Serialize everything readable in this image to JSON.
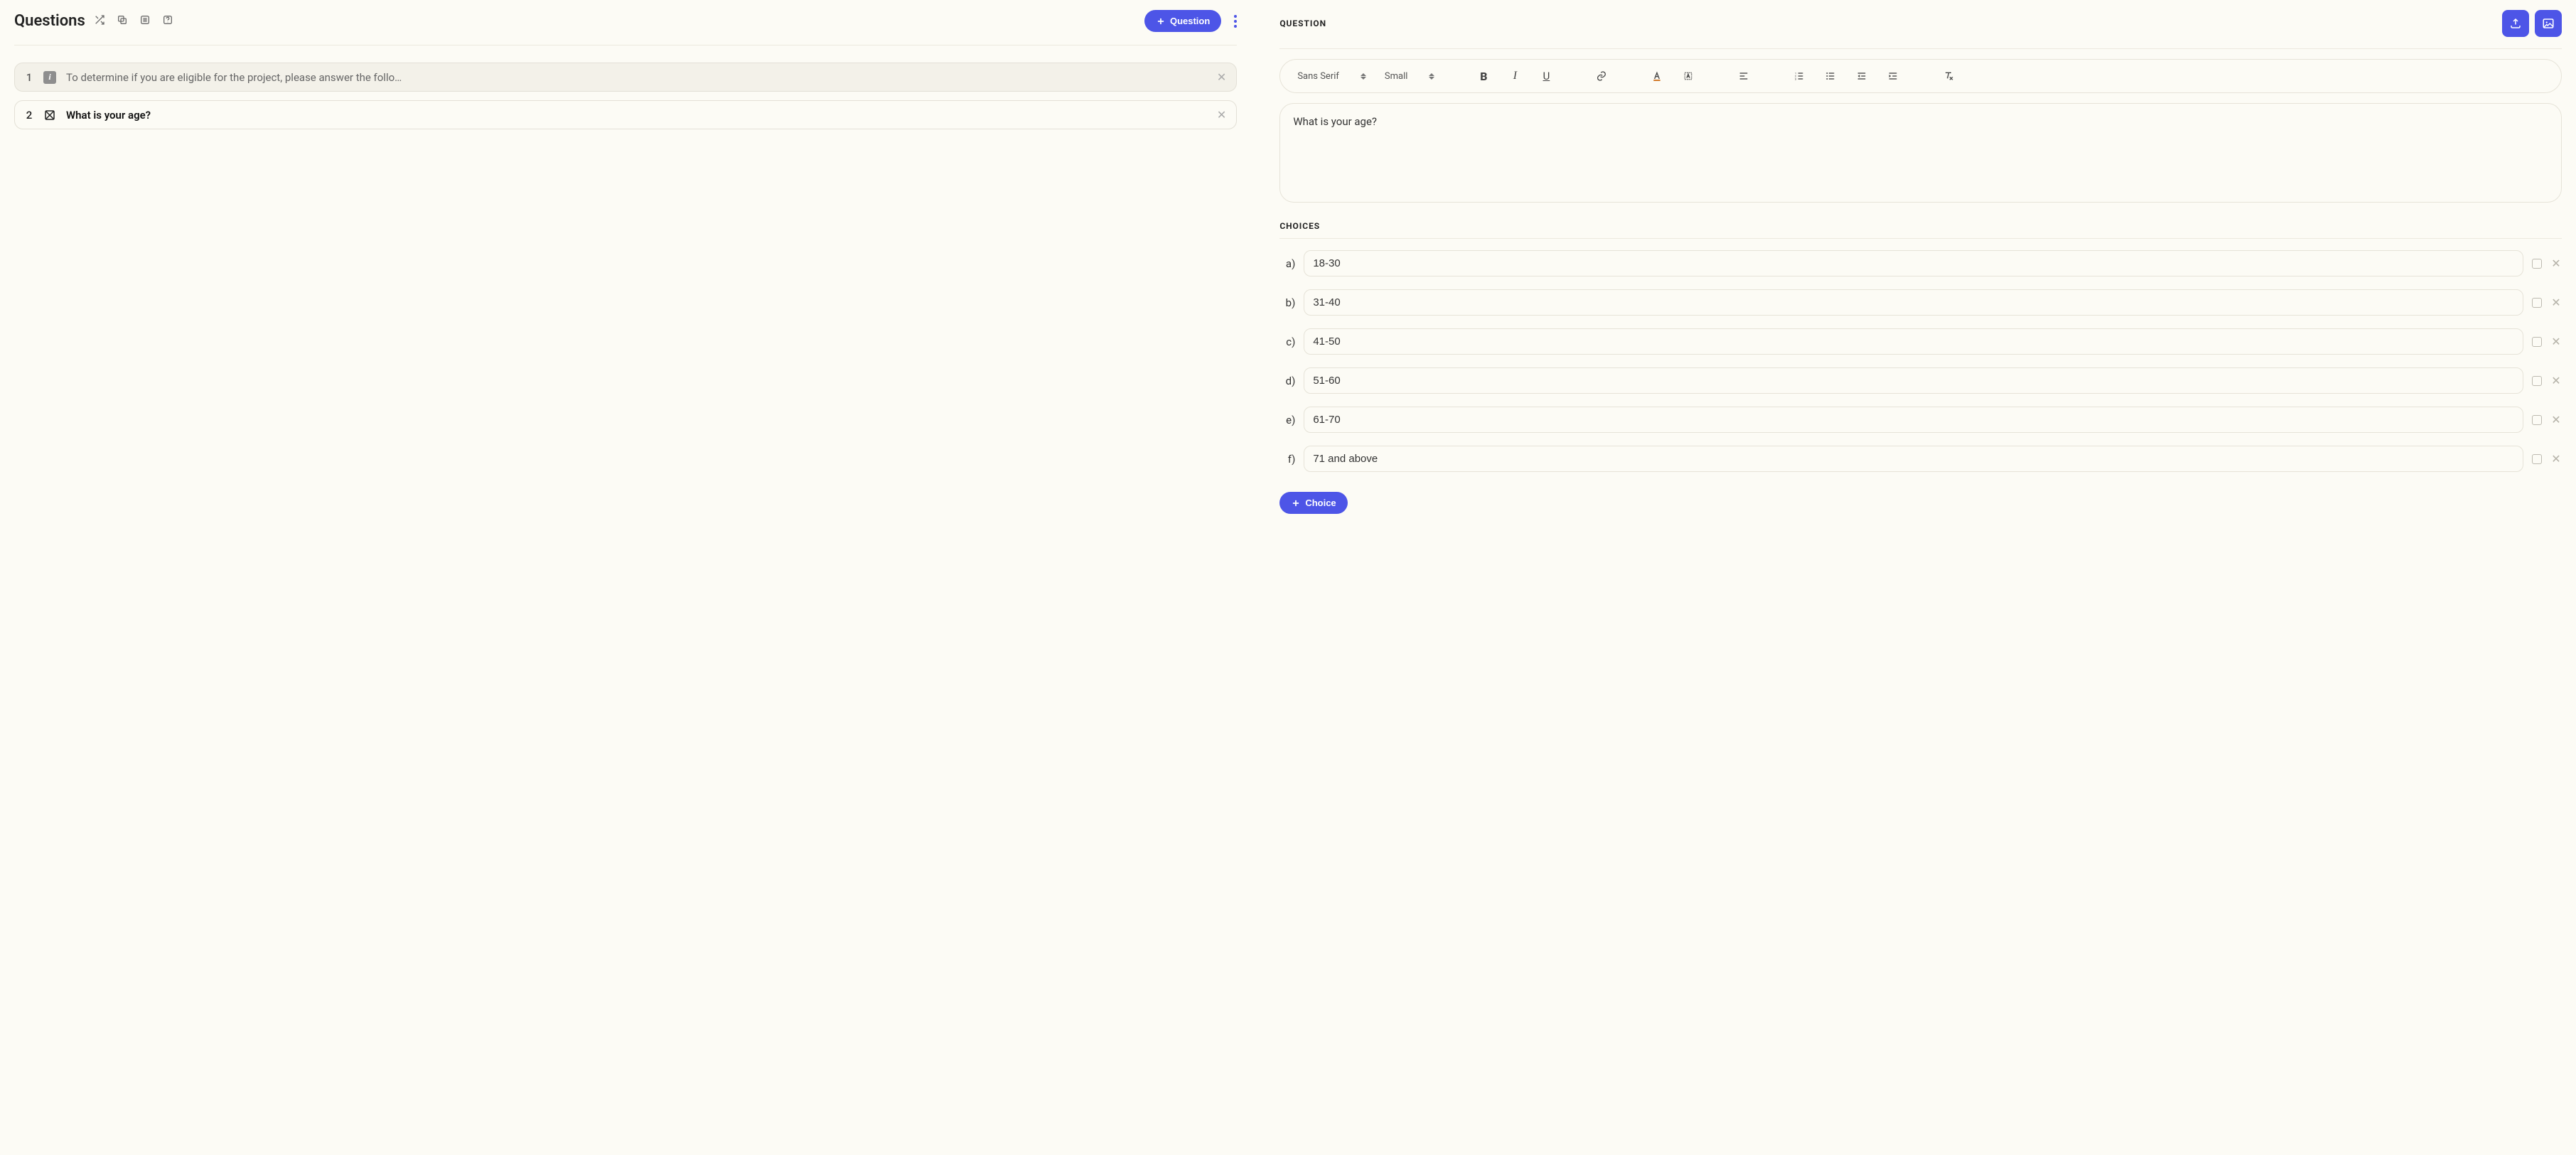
{
  "header": {
    "title": "Questions",
    "add_question_label": "Question"
  },
  "questions": [
    {
      "num": "1",
      "type": "info",
      "text": "To determine if you are eligible for the project, please answer the follo…",
      "selected": false
    },
    {
      "num": "2",
      "type": "mc",
      "text": "What is your age?",
      "selected": true
    }
  ],
  "right": {
    "section_question_label": "QUESTION",
    "section_choices_label": "CHOICES",
    "question_text": "What is your age?",
    "toolbar": {
      "font_family": "Sans Serif",
      "font_size": "Small"
    },
    "choices": [
      {
        "label": "a)",
        "value": "18-30"
      },
      {
        "label": "b)",
        "value": "31-40"
      },
      {
        "label": "c)",
        "value": "41-50"
      },
      {
        "label": "d)",
        "value": "51-60"
      },
      {
        "label": "e)",
        "value": "61-70"
      },
      {
        "label": "f)",
        "value": "71 and above"
      }
    ],
    "add_choice_label": "Choice"
  }
}
